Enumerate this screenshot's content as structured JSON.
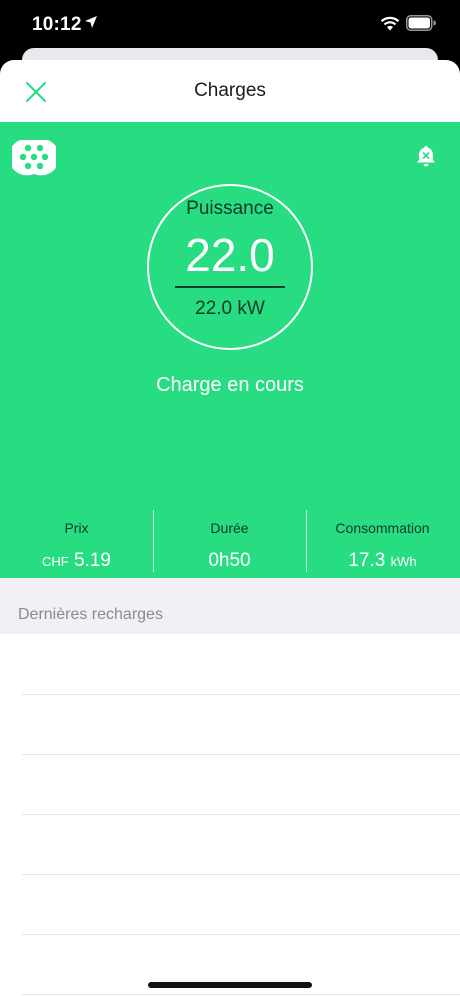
{
  "status_bar": {
    "time": "10:12"
  },
  "nav": {
    "title": "Charges"
  },
  "gauge": {
    "label": "Puissance",
    "value": "22.0",
    "sub": "22.0 kW"
  },
  "charge_status": "Charge en cours",
  "stats": [
    {
      "label": "Prix",
      "prefix": "CHF",
      "value": "5.19",
      "unit": ""
    },
    {
      "label": "Durée",
      "prefix": "",
      "value": "0h50",
      "unit": ""
    },
    {
      "label": "Consommation",
      "prefix": "",
      "value": "17.3",
      "unit": "kWh"
    }
  ],
  "recent": {
    "title": "Dernières recharges"
  },
  "colors": {
    "accent": "#28dc82",
    "dark_text": "#0b3b2a",
    "section_bg": "#f1f1f5"
  }
}
